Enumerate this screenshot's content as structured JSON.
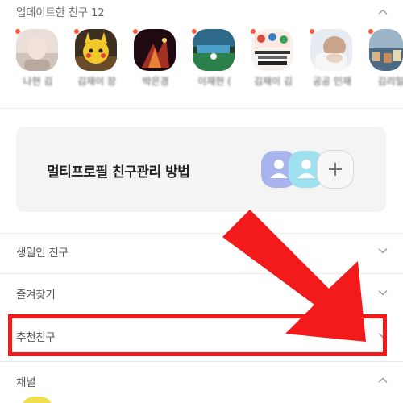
{
  "updated_friends": {
    "title": "업데이트한 친구 12",
    "friends": [
      {
        "name": "나현 김",
        "colors": [
          "#d8cfc8",
          "#f2e6e0"
        ]
      },
      {
        "name": "김재이 장",
        "colors": [
          "#3a2a18",
          "#f0c928"
        ]
      },
      {
        "name": "박은경",
        "colors": [
          "#2a0d12",
          "#d94a2a"
        ]
      },
      {
        "name": "이재현 (",
        "colors": [
          "#1c3a2a",
          "#2b8bb8"
        ]
      },
      {
        "name": "김재이 김",
        "colors": [
          "#f6f2ee",
          "#c8463a"
        ]
      },
      {
        "name": "공공 인재",
        "colors": [
          "#dfe6ee",
          "#b58a6c"
        ]
      },
      {
        "name": "김리일",
        "colors": [
          "#4c6a84",
          "#d6b48a"
        ]
      }
    ]
  },
  "multi_profile": {
    "title": "멀티프로필 친구관리 방법",
    "colors": {
      "left": "#a9b4ef",
      "middle": "#9fe0ee",
      "right": "#f7f7f7"
    }
  },
  "sections": {
    "birthday": "생일인 친구",
    "favorites": "즐겨찾기",
    "recommended": "추천친구",
    "channel": "채널"
  },
  "accent": {
    "highlight": "#f21a1a",
    "arrow": "#f21a1a"
  }
}
